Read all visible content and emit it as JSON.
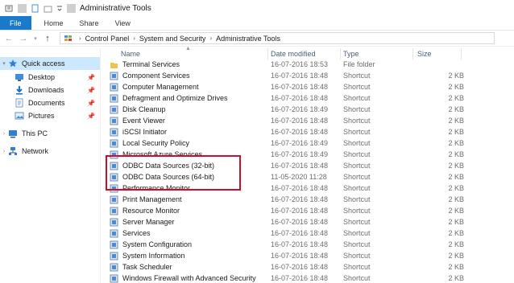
{
  "window": {
    "title": "Administrative Tools"
  },
  "ribbon": {
    "tabs": [
      "File",
      "Home",
      "Share",
      "View"
    ]
  },
  "address": {
    "crumbs": [
      "Control Panel",
      "System and Security",
      "Administrative Tools"
    ]
  },
  "nav": {
    "items": [
      {
        "label": "Quick access"
      },
      {
        "label": "Desktop"
      },
      {
        "label": "Downloads"
      },
      {
        "label": "Documents"
      },
      {
        "label": "Pictures"
      },
      {
        "label": "This PC"
      },
      {
        "label": "Network"
      }
    ]
  },
  "columns": {
    "name": "Name",
    "date": "Date modified",
    "type": "Type",
    "size": "Size"
  },
  "files": [
    {
      "name": "Terminal Services",
      "date": "16-07-2016 18:53",
      "type": "File folder",
      "size": ""
    },
    {
      "name": "Component Services",
      "date": "16-07-2016 18:48",
      "type": "Shortcut",
      "size": "2 KB"
    },
    {
      "name": "Computer Management",
      "date": "16-07-2016 18:48",
      "type": "Shortcut",
      "size": "2 KB"
    },
    {
      "name": "Defragment and Optimize Drives",
      "date": "16-07-2016 18:48",
      "type": "Shortcut",
      "size": "2 KB"
    },
    {
      "name": "Disk Cleanup",
      "date": "16-07-2016 18:49",
      "type": "Shortcut",
      "size": "2 KB"
    },
    {
      "name": "Event Viewer",
      "date": "16-07-2016 18:48",
      "type": "Shortcut",
      "size": "2 KB"
    },
    {
      "name": "iSCSI Initiator",
      "date": "16-07-2016 18:48",
      "type": "Shortcut",
      "size": "2 KB"
    },
    {
      "name": "Local Security Policy",
      "date": "16-07-2016 18:49",
      "type": "Shortcut",
      "size": "2 KB"
    },
    {
      "name": "Microsoft Azure Services",
      "date": "16-07-2016 18:49",
      "type": "Shortcut",
      "size": "2 KB"
    },
    {
      "name": "ODBC Data Sources (32-bit)",
      "date": "16-07-2016 18:48",
      "type": "Shortcut",
      "size": "2 KB"
    },
    {
      "name": "ODBC Data Sources (64-bit)",
      "date": "11-05-2020 11:28",
      "type": "Shortcut",
      "size": "2 KB"
    },
    {
      "name": "Performance Monitor",
      "date": "16-07-2016 18:48",
      "type": "Shortcut",
      "size": "2 KB"
    },
    {
      "name": "Print Management",
      "date": "16-07-2016 18:48",
      "type": "Shortcut",
      "size": "2 KB"
    },
    {
      "name": "Resource Monitor",
      "date": "16-07-2016 18:48",
      "type": "Shortcut",
      "size": "2 KB"
    },
    {
      "name": "Server Manager",
      "date": "16-07-2016 18:48",
      "type": "Shortcut",
      "size": "2 KB"
    },
    {
      "name": "Services",
      "date": "16-07-2016 18:48",
      "type": "Shortcut",
      "size": "2 KB"
    },
    {
      "name": "System Configuration",
      "date": "16-07-2016 18:48",
      "type": "Shortcut",
      "size": "2 KB"
    },
    {
      "name": "System Information",
      "date": "16-07-2016 18:48",
      "type": "Shortcut",
      "size": "2 KB"
    },
    {
      "name": "Task Scheduler",
      "date": "16-07-2016 18:48",
      "type": "Shortcut",
      "size": "2 KB"
    },
    {
      "name": "Windows Firewall with Advanced Security",
      "date": "16-07-2016 18:48",
      "type": "Shortcut",
      "size": "2 KB"
    }
  ],
  "colors": {
    "accent": "#1979ca",
    "selection": "#cce8ff",
    "highlight_box": "#c8102e"
  }
}
